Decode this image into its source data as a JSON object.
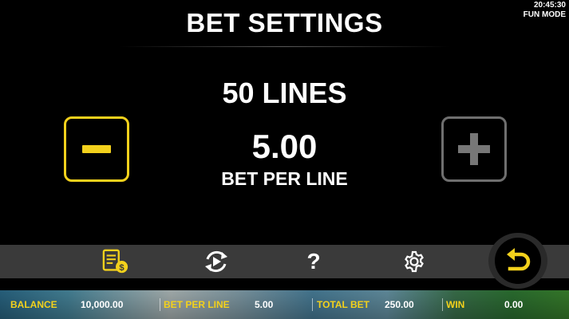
{
  "status": {
    "time": "20:45:30",
    "mode": "FUN MODE"
  },
  "header": {
    "title": "BET SETTINGS"
  },
  "settings": {
    "lines_text": "50 LINES",
    "bet_value": "5.00",
    "bet_caption": "BET PER LINE"
  },
  "toolbar": {
    "icons": [
      "paytable-icon",
      "autoplay-icon",
      "help-icon",
      "settings-gear-icon",
      "back-arrow-icon"
    ],
    "help_glyph": "?"
  },
  "infobar": {
    "balance_label": "BALANCE",
    "balance_value": "10,000.00",
    "bet_per_line_label": "BET PER LINE",
    "bet_per_line_value": "5.00",
    "total_bet_label": "TOTAL BET",
    "total_bet_value": "250.00",
    "win_label": "WIN",
    "win_value": "0.00"
  },
  "colors": {
    "accent_yellow": "#f3d11c",
    "disabled_gray": "#6f6f6f",
    "toolbar_bg": "#3a3a3a"
  }
}
